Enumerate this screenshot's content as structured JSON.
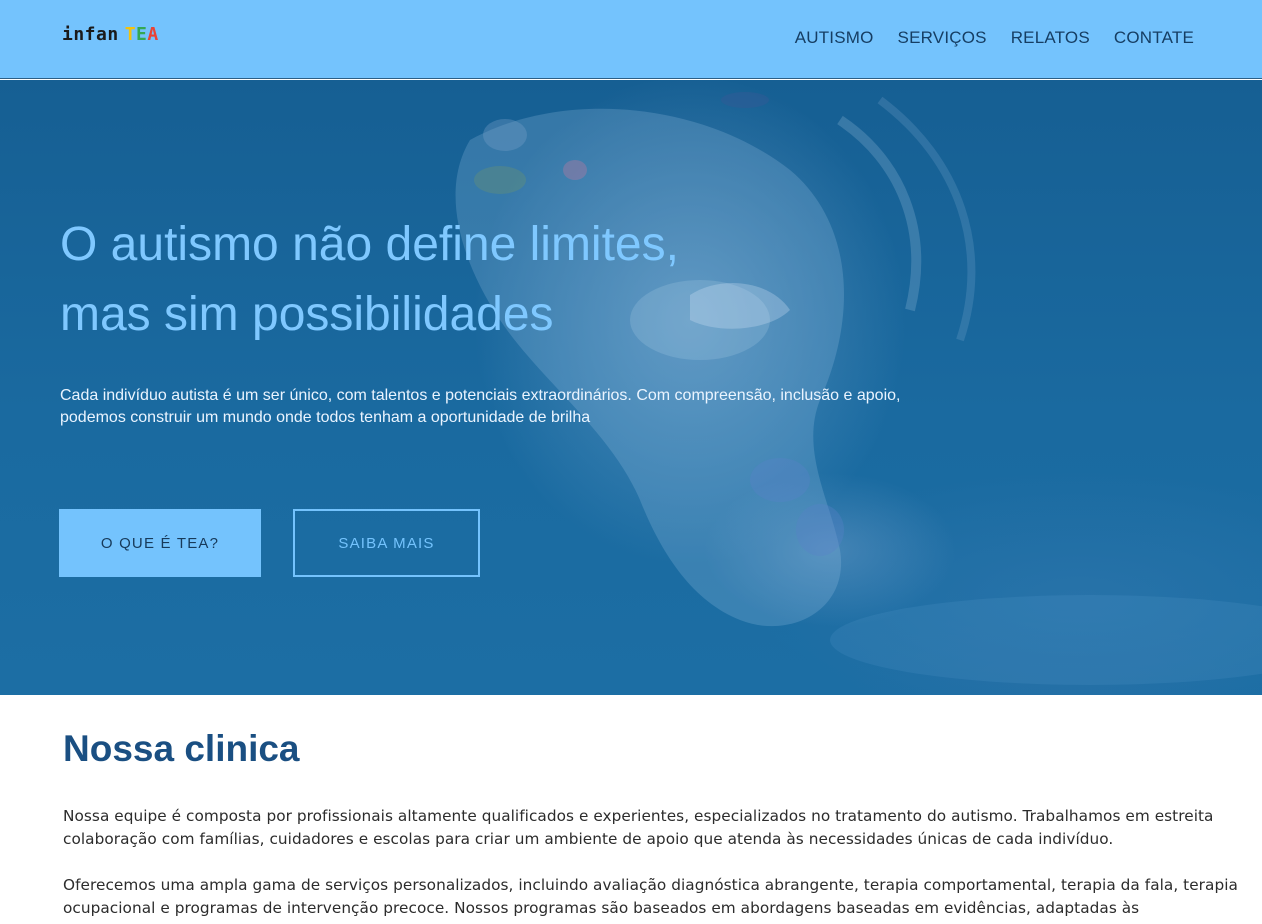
{
  "header": {
    "logo": {
      "word1": "infan",
      "letters": [
        {
          "char": "T",
          "color": "#f4c20d"
        },
        {
          "char": "E",
          "color": "#34a853"
        },
        {
          "char": "A",
          "color": "#ea4335"
        }
      ]
    },
    "nav": [
      {
        "label": "AUTISMO"
      },
      {
        "label": "SERVIÇOS"
      },
      {
        "label": "RELATOS"
      },
      {
        "label": "CONTATE"
      }
    ]
  },
  "hero": {
    "title_line1": "O autismo não define limites,",
    "title_line2": "mas sim possibilidades",
    "text": "Cada indivíduo autista é um ser único, com talentos e potenciais extraordinários. Com compreensão, inclusão e apoio, podemos construir um mundo onde todos tenham a oportunidade de brilha",
    "primary_button": "O QUE É TEA?",
    "secondary_button": "SAIBA MAIS"
  },
  "clinic": {
    "title": "Nossa clinica",
    "paragraph1": "Nossa equipe é composta por profissionais altamente qualificados e experientes, especializados no tratamento do autismo. Trabalhamos em estreita colaboração com famílias, cuidadores e escolas para criar um ambiente de apoio que atenda às necessidades únicas de cada indivíduo.",
    "paragraph2": "Oferecemos uma ampla gama de serviços personalizados, incluindo avaliação diagnóstica abrangente, terapia comportamental, terapia da fala, terapia ocupacional e programas de intervenção precoce. Nossos programas são baseados em abordagens baseadas em evidências, adaptadas às"
  },
  "colors": {
    "header_bg": "#74c3fd",
    "hero_bg": "#1a6aa0",
    "hero_title": "#7fc8ff",
    "section_title": "#1a4f82"
  }
}
